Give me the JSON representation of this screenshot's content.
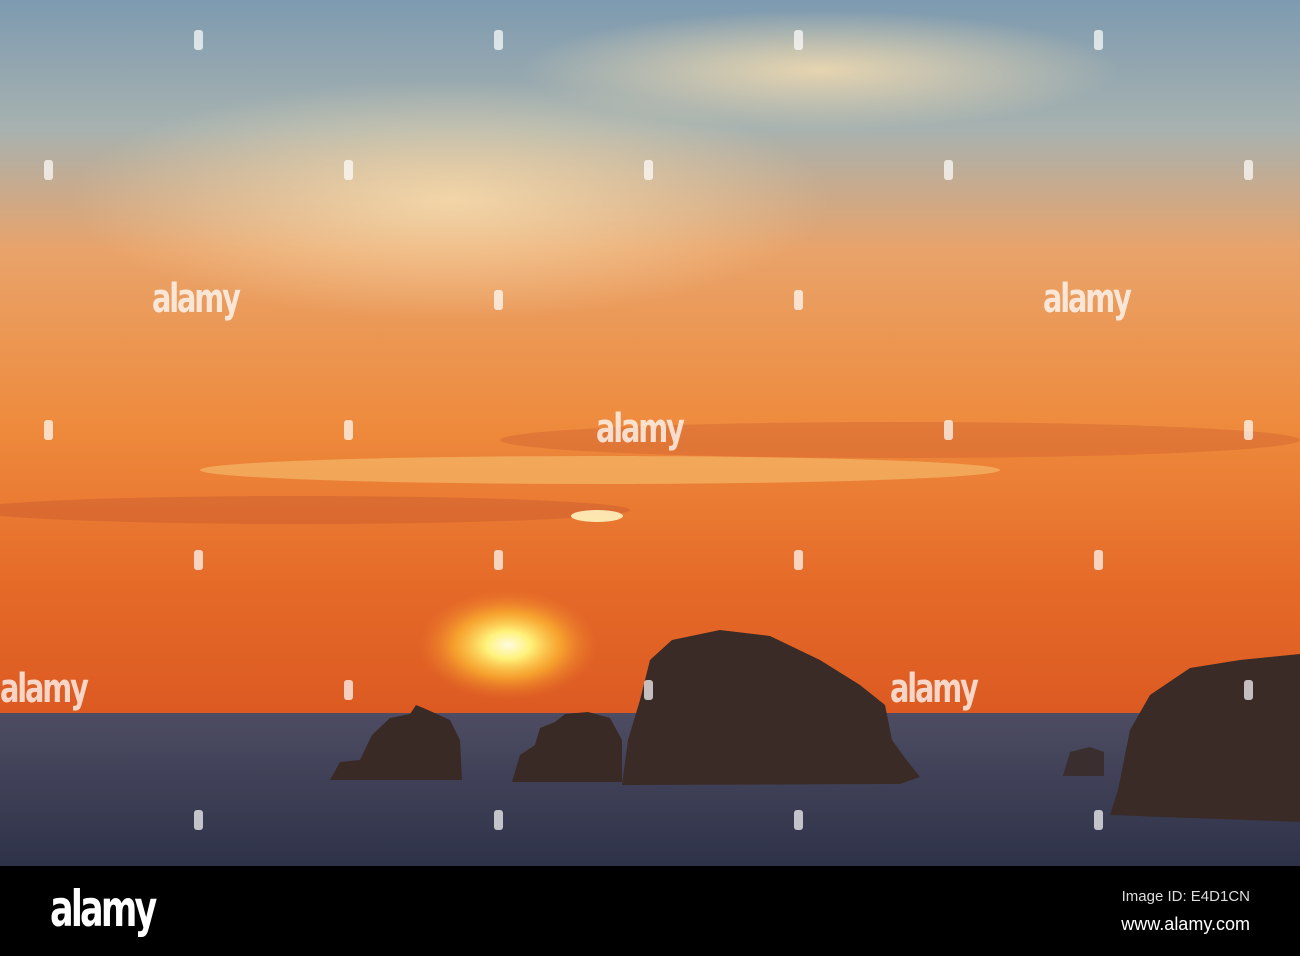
{
  "watermark": {
    "text": "alamy"
  },
  "footer": {
    "logo": "alamy",
    "image_id": "Image ID: E4D1CN",
    "url": "www.alamy.com"
  }
}
